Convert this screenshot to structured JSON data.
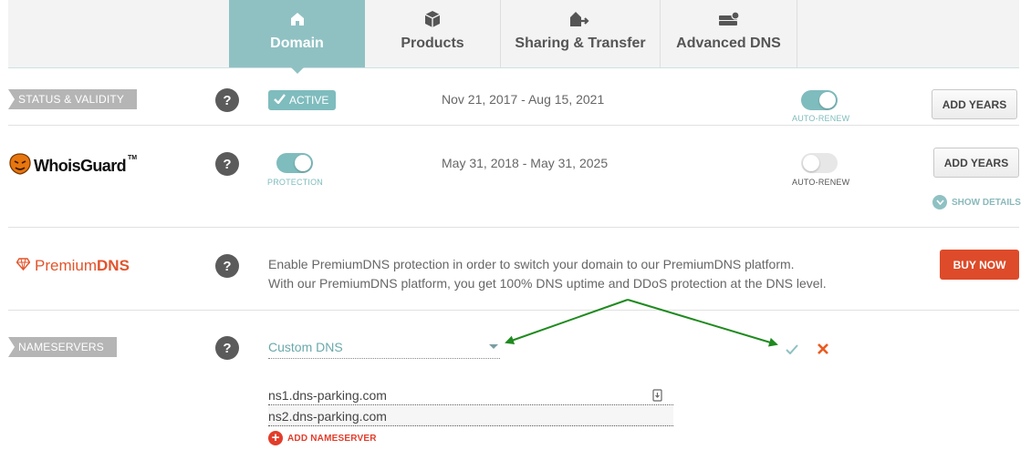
{
  "tabs": [
    {
      "label": "Domain",
      "icon": "home-icon",
      "active": true
    },
    {
      "label": "Products",
      "icon": "box-icon",
      "active": false
    },
    {
      "label": "Sharing & Transfer",
      "icon": "transfer-icon",
      "active": false
    },
    {
      "label": "Advanced DNS",
      "icon": "server-icon",
      "active": false
    }
  ],
  "status": {
    "ribbon": "STATUS & VALIDITY",
    "help": "?",
    "badge": "ACTIVE",
    "dates": "Nov 21, 2017 - Aug 15, 2021",
    "autorenew_label": "AUTO-RENEW",
    "autorenew_on": true,
    "button": "ADD YEARS"
  },
  "whoisguard": {
    "logo_text": "WhoisGuard",
    "logo_tm": "TM",
    "help": "?",
    "protection_label": "PROTECTION",
    "protection_on": true,
    "dates": "May 31, 2018 - May 31, 2025",
    "autorenew_label": "AUTO-RENEW",
    "autorenew_on": false,
    "button": "ADD YEARS",
    "show_details": "SHOW DETAILS"
  },
  "premiumdns": {
    "logo_prefix": "Premium",
    "logo_suffix": "DNS",
    "help": "?",
    "desc_line1": "Enable PremiumDNS protection in order to switch your domain to our PremiumDNS platform.",
    "desc_line2": "With our PremiumDNS platform, you get 100% DNS uptime and DDoS protection at the DNS level.",
    "button": "BUY NOW"
  },
  "nameservers": {
    "ribbon": "NAMESERVERS",
    "help": "?",
    "selected": "Custom DNS",
    "ns": [
      "ns1.dns-parking.com",
      "ns2.dns-parking.com"
    ],
    "add_label": "ADD NAMESERVER"
  },
  "colors": {
    "accent_teal": "#8fc1c3",
    "buy_red": "#dd4b2a",
    "annotation_green": "#1f8a1f"
  }
}
